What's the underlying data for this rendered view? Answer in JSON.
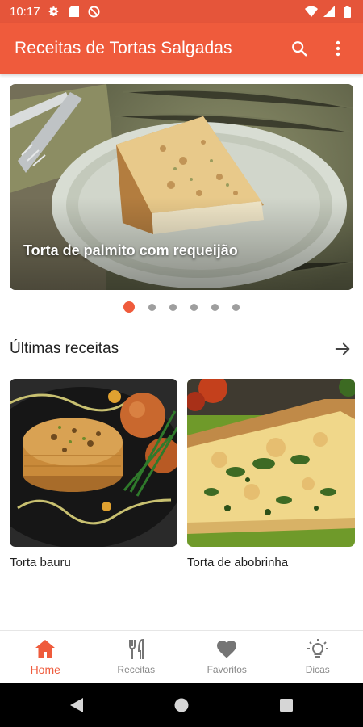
{
  "status_bar": {
    "time": "10:17",
    "left_icons": [
      "gear-icon",
      "sd-card-icon",
      "no-disturb-icon"
    ],
    "right_icons": [
      "wifi-icon",
      "cell-signal-icon",
      "battery-icon"
    ]
  },
  "app_bar": {
    "title": "Receitas de Tortas Salgadas",
    "actions": [
      "search-icon",
      "more-vert-icon"
    ]
  },
  "carousel": {
    "caption": "Torta de palmito com requeijão",
    "image": "torta-palmito-photo",
    "page_count": 6,
    "active_page": 1
  },
  "latest": {
    "title": "Últimas receitas",
    "arrow_icon": "arrow-right-icon",
    "cards": [
      {
        "label": "Torta bauru",
        "image": "torta-bauru-photo"
      },
      {
        "label": "Torta de abobrinha",
        "image": "torta-abobrinha-photo"
      }
    ]
  },
  "bottom_nav": {
    "items": [
      {
        "label": "Home",
        "icon": "home-icon",
        "active": true
      },
      {
        "label": "Receitas",
        "icon": "fork-knife-icon",
        "active": false
      },
      {
        "label": "Favoritos",
        "icon": "heart-icon",
        "active": false
      },
      {
        "label": "Dicas",
        "icon": "lightbulb-icon",
        "active": false
      }
    ]
  },
  "colors": {
    "primary": "#ef5b3c",
    "status_bar": "#e5553a",
    "dot_inactive": "#9e9e9e",
    "nav_inactive": "#8a8a8a"
  }
}
